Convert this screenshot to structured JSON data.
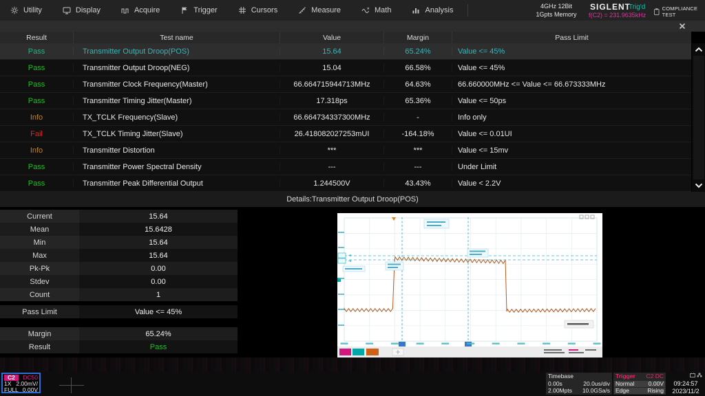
{
  "menu": {
    "items": [
      {
        "label": "Utility",
        "icon": "gear-icon"
      },
      {
        "label": "Display",
        "icon": "display-icon"
      },
      {
        "label": "Acquire",
        "icon": "acquire-icon"
      },
      {
        "label": "Trigger",
        "icon": "trigger-flag-icon"
      },
      {
        "label": "Cursors",
        "icon": "cursors-icon"
      },
      {
        "label": "Measure",
        "icon": "measure-icon"
      },
      {
        "label": "Math",
        "icon": "math-icon"
      },
      {
        "label": "Analysis",
        "icon": "analysis-icon"
      }
    ]
  },
  "status_cluster": {
    "bandwidth": "4GHz 12Bit",
    "memory": "1Gpts Memory",
    "brand": "SIGLENT",
    "trigger_state": "Trig'd",
    "frequency_readout": "f(C2) = 231.9635kHz",
    "app_title": "COMPLIANCE TEST"
  },
  "results_table": {
    "headers": [
      "Result",
      "Test name",
      "Value",
      "Margin",
      "Pass Limit"
    ],
    "rows": [
      {
        "result": "Pass",
        "status": "pass",
        "selected": true,
        "name": "Transmitter Output Droop(POS)",
        "value": "15.64",
        "margin": "65.24%",
        "limit": "Value <= 45%"
      },
      {
        "result": "Pass",
        "status": "pass",
        "name": "Transmitter Output Droop(NEG)",
        "value": "15.04",
        "margin": "66.58%",
        "limit": "Value <= 45%"
      },
      {
        "result": "Pass",
        "status": "pass",
        "name": "Transmitter Clock Frequency(Master)",
        "value": "66.664715944713MHz",
        "margin": "64.63%",
        "limit": "66.660000MHz <= Value <= 66.673333MHz"
      },
      {
        "result": "Pass",
        "status": "pass",
        "name": "Transmitter Timing Jitter(Master)",
        "value": "17.318ps",
        "margin": "65.36%",
        "limit": "Value <= 50ps"
      },
      {
        "result": "Info",
        "status": "info",
        "name": "TX_TCLK Frequency(Slave)",
        "value": "66.664734337300MHz",
        "margin": "-",
        "limit": "Info only"
      },
      {
        "result": "Fail",
        "status": "fail",
        "name": "TX_TCLK Timing Jitter(Slave)",
        "value": "26.418082027253mUI",
        "margin": "-164.18%",
        "limit": "Value <= 0.01UI"
      },
      {
        "result": "Info",
        "status": "info",
        "name": "Transmitter Distortion",
        "value": "***",
        "margin": "***",
        "limit": "Value <= 15mv"
      },
      {
        "result": "Pass",
        "status": "pass",
        "name": "Transmitter Power Spectral Density",
        "value": "---",
        "margin": "---",
        "limit": "Under Limit"
      },
      {
        "result": "Pass",
        "status": "pass",
        "name": "Transmitter Peak Differential Output",
        "value": "1.244500V",
        "margin": "43.43%",
        "limit": "Value < 2.2V"
      }
    ]
  },
  "details": {
    "title": "Details:Transmitter Output Droop(POS)",
    "stats": [
      {
        "label": "Current",
        "value": "15.64"
      },
      {
        "label": "Mean",
        "value": "15.6428"
      },
      {
        "label": "Min",
        "value": "15.64"
      },
      {
        "label": "Max",
        "value": "15.64"
      },
      {
        "label": "Pk-Pk",
        "value": "0.00"
      },
      {
        "label": "Stdev",
        "value": "0.00"
      },
      {
        "label": "Count",
        "value": "1"
      },
      {
        "label": "Pass Limit",
        "value": "Value <= 45%",
        "gap": "gap1"
      },
      {
        "label": "Margin",
        "value": "65.24%",
        "gap": "gap2"
      },
      {
        "label": "Result",
        "value": "Pass",
        "status": "pass"
      }
    ]
  },
  "channel_box": {
    "name": "C2",
    "coupling": "DC50",
    "atten": "1X",
    "scale": "2.00mV/",
    "bandwidth": "FULL",
    "offset": "0.00V"
  },
  "timebase": {
    "label": "Timebase",
    "delay": "0.00s",
    "scale": "20.0us/div",
    "points": "2.00Mpts",
    "rate": "10.0GSa/s"
  },
  "trigger": {
    "label": "Trigger",
    "source": "C2 DC",
    "mode": "Normal",
    "level": "0.00V",
    "type": "Edge",
    "slope": "Rising"
  },
  "clock": {
    "time": "09:24:57",
    "date": "2023/11/2"
  },
  "colors": {
    "pass": "#1ec11e",
    "info": "#c8821e",
    "fail": "#d42a2a",
    "selected_text": "#35b8b8",
    "magenta": "#e0218a",
    "trigd": "#00c8b4",
    "channel_border": "#2e6fd6",
    "waveform": "#b4581e"
  }
}
